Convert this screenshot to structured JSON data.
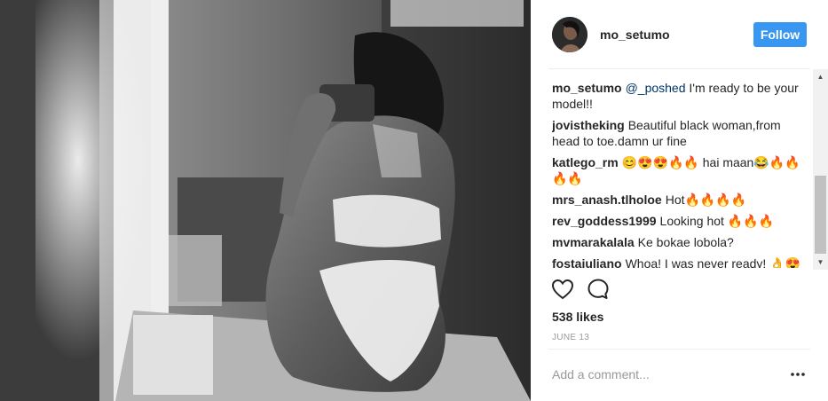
{
  "post": {
    "username": "mo_setumo",
    "follow_label": "Follow",
    "likes": "538 likes",
    "date": "JUNE 13",
    "comment_placeholder": "Add a comment..."
  },
  "comments": [
    {
      "user": "mo_setumo",
      "mention": "@_poshed",
      "text": " I'm ready to be your model!!"
    },
    {
      "user": "jovistheking",
      "mention": "",
      "text": "Beautiful black woman,from head to toe.damn ur fine"
    },
    {
      "user": "katlego_rm",
      "mention": "",
      "text": "😊😍😍🔥🔥 hai maan😂🔥🔥🔥🔥"
    },
    {
      "user": "mrs_anash.tlholoe",
      "mention": "",
      "text": "Hot🔥🔥🔥🔥"
    },
    {
      "user": "rev_goddess1999",
      "mention": "",
      "text": "Looking hot 🔥🔥🔥"
    },
    {
      "user": "mvmarakalala",
      "mention": "",
      "text": "Ke bokae lobola?"
    },
    {
      "user": "fostajuliano",
      "mention": "",
      "text": "Whoa! I was never ready! 👌😍"
    }
  ],
  "icons": {
    "like": "heart-icon",
    "comment": "comment-bubble-icon",
    "more": "more-options-icon"
  },
  "colors": {
    "follow_button": "#3897f0",
    "mention": "#003569",
    "secondary_text": "#999999"
  }
}
